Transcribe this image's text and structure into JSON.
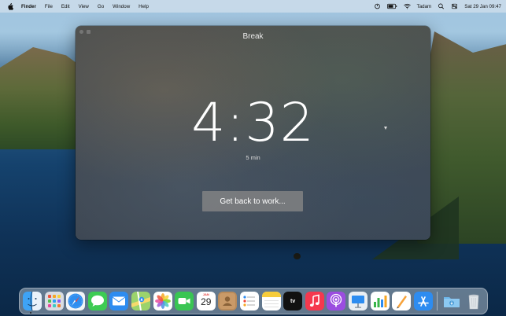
{
  "menubar": {
    "app_name": "Finder",
    "menus": [
      "File",
      "Edit",
      "View",
      "Go",
      "Window",
      "Help"
    ],
    "user_name": "Tadam",
    "datetime": "Sat 29 Jan  09:47"
  },
  "break_window": {
    "title": "Break",
    "timer": "4:32",
    "duration_label": "5 min",
    "button_label": "Get back to work..."
  },
  "dock": {
    "apps": [
      "finder-icon",
      "launchpad-icon",
      "safari-icon",
      "messages-icon",
      "mail-icon",
      "maps-icon",
      "photos-icon",
      "facetime-icon",
      "calendar-icon",
      "contacts-icon",
      "reminders-icon",
      "notes-icon",
      "apple-tv-icon",
      "music-icon",
      "podcasts-icon",
      "keynote-icon",
      "numbers-icon",
      "pages-icon",
      "app-store-icon",
      "downloads-folder-icon",
      "trash-icon"
    ],
    "calendar": {
      "month": "JAN",
      "day": "29"
    },
    "tv_label": "tv"
  },
  "colors": {
    "menubar_bg": "#d2e0ec",
    "window_bg": "#434a52",
    "button_bg": "#878787",
    "text_light": "#ffffff"
  }
}
